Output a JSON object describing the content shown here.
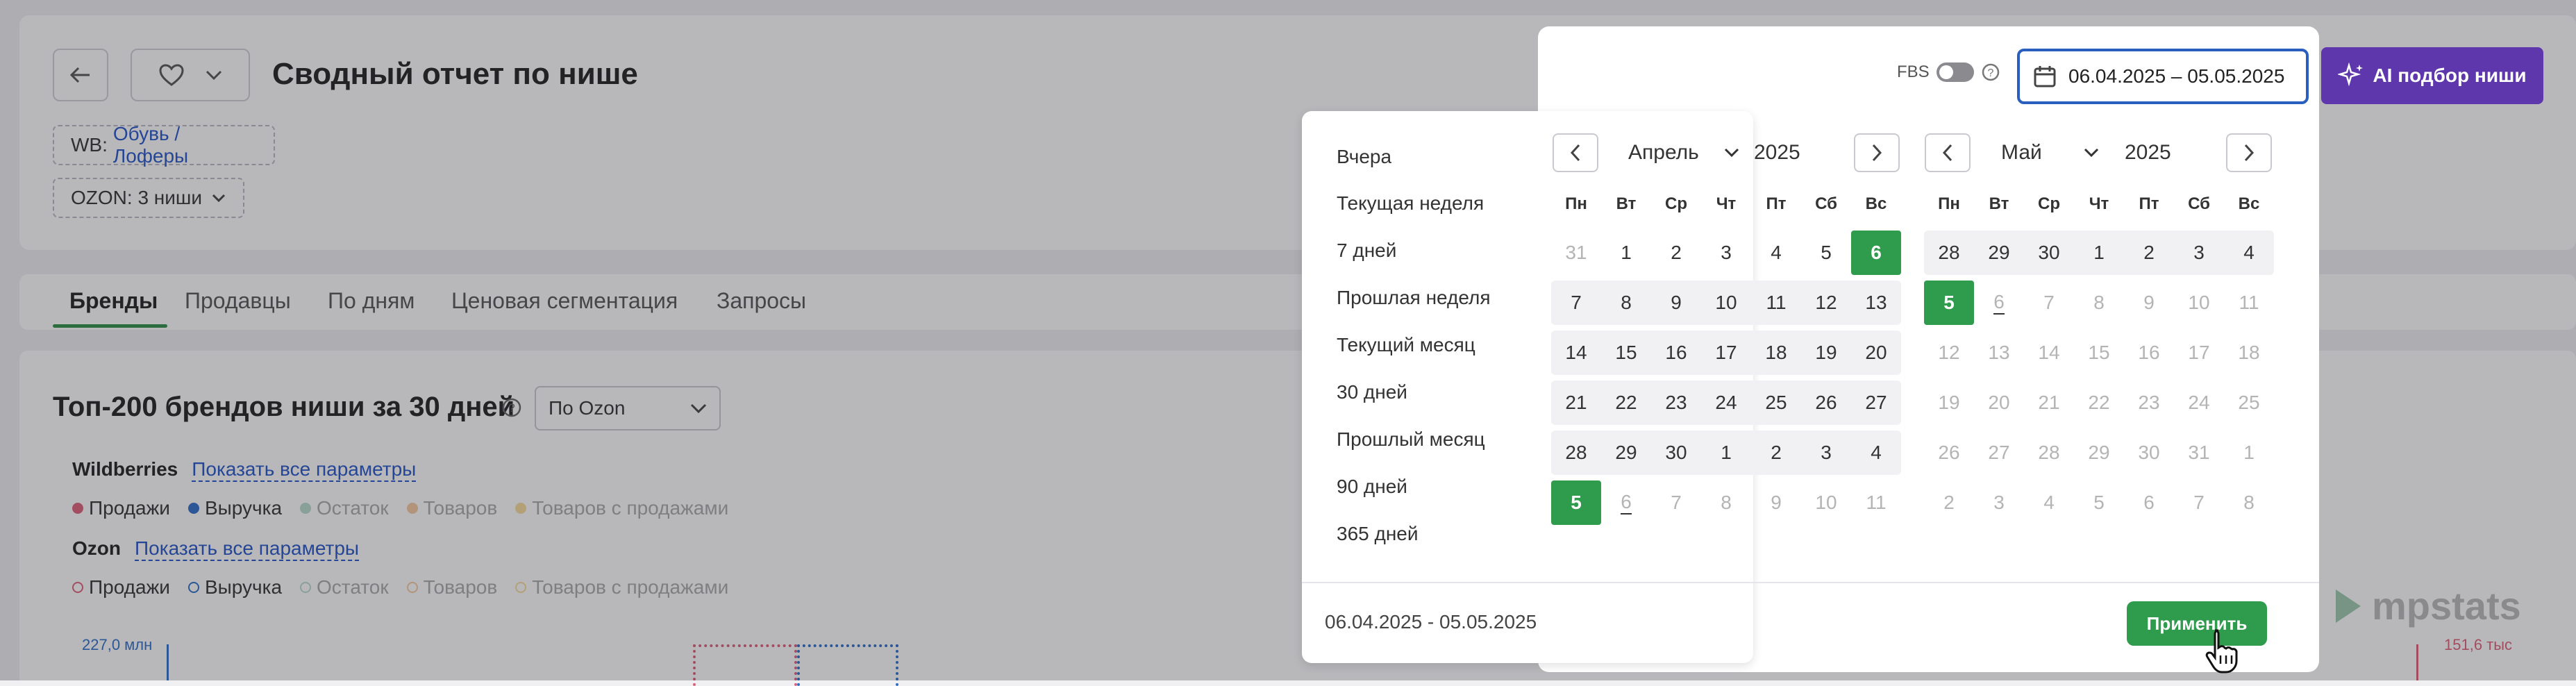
{
  "header": {
    "title": "Сводный отчет по нише",
    "wb_label": "WB:",
    "wb_link": "Обувь / Лоферы",
    "ozon_label": "OZON: 3 ниши"
  },
  "tabs": [
    {
      "label": "Бренды"
    },
    {
      "label": "Продавцы"
    },
    {
      "label": "По дням"
    },
    {
      "label": "Ценовая сегментация"
    },
    {
      "label": "Запросы"
    }
  ],
  "section": {
    "title": "Топ-200 брендов ниши за 30 дней",
    "dropdown_value": "По Ozon",
    "wb_label": "Wildberries",
    "ozon_label": "Ozon",
    "show_all_label": "Показать все параметры",
    "legend": [
      "Продажи",
      "Выручка",
      "Остаток",
      "Товаров",
      "Товаров с продажами"
    ],
    "chart_left_tick": "227,0 млн",
    "chart_right_tick": "151,6 тыс"
  },
  "colors": {
    "sales": "#e0607a",
    "revenue": "#2f6fc9",
    "stock": "#7cc4a4",
    "items": "#f0a15a",
    "items_sold": "#f5c04a"
  },
  "fbs": {
    "label": "FBS",
    "help": "?"
  },
  "date_input": {
    "value": "06.04.2025 – 05.05.2025"
  },
  "ai_button": {
    "label": "AI подбор ниши"
  },
  "presets": [
    "Вчера",
    "Текущая неделя",
    "7 дней",
    "Прошлая неделя",
    "Текущий месяц",
    "30 дней",
    "Прошлый месяц",
    "90 дней",
    "365 дней"
  ],
  "range_text": "06.04.2025 - 05.05.2025",
  "apply_label": "Применить",
  "logo_text": "mpstats",
  "weekdays": [
    "Пн",
    "Вт",
    "Ср",
    "Чт",
    "Пт",
    "Сб",
    "Вс"
  ],
  "cal_left": {
    "month": "Апрель",
    "year": "2025",
    "weeks": [
      [
        "31",
        "1",
        "2",
        "3",
        "4",
        "5",
        "6"
      ],
      [
        "7",
        "8",
        "9",
        "10",
        "11",
        "12",
        "13"
      ],
      [
        "14",
        "15",
        "16",
        "17",
        "18",
        "19",
        "20"
      ],
      [
        "21",
        "22",
        "23",
        "24",
        "25",
        "26",
        "27"
      ],
      [
        "28",
        "29",
        "30",
        "1",
        "2",
        "3",
        "4"
      ],
      [
        "5",
        "6",
        "7",
        "8",
        "9",
        "10",
        "11"
      ]
    ]
  },
  "cal_right": {
    "month": "Май",
    "year": "2025",
    "weeks": [
      [
        "28",
        "29",
        "30",
        "1",
        "2",
        "3",
        "4"
      ],
      [
        "5",
        "6",
        "7",
        "8",
        "9",
        "10",
        "11"
      ],
      [
        "12",
        "13",
        "14",
        "15",
        "16",
        "17",
        "18"
      ],
      [
        "19",
        "20",
        "21",
        "22",
        "23",
        "24",
        "25"
      ],
      [
        "26",
        "27",
        "28",
        "29",
        "30",
        "31",
        "1"
      ],
      [
        "2",
        "3",
        "4",
        "5",
        "6",
        "7",
        "8"
      ]
    ]
  }
}
